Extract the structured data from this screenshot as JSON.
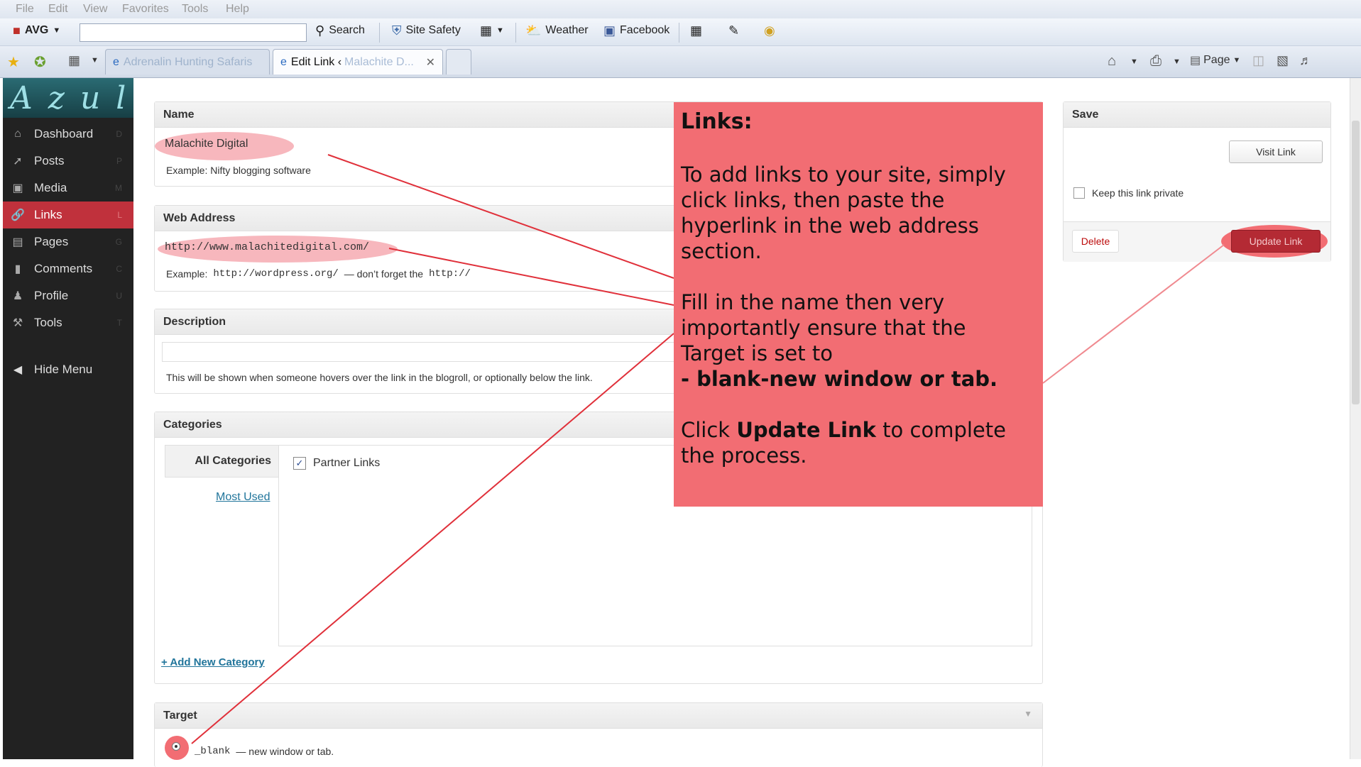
{
  "browser": {
    "menu": [
      "File",
      "Edit",
      "View",
      "Favorites",
      "Tools",
      "Help"
    ],
    "toolbar": {
      "avg": "AVG",
      "search": "Search",
      "site_safety": "Site Safety",
      "weather": "Weather",
      "facebook": "Facebook"
    },
    "tabs": [
      {
        "label": "Adrenalin Hunting Safaris"
      },
      {
        "label": "Edit Link ‹",
        "faded": "Malachite D..."
      }
    ],
    "command_bar": {
      "page": "Page"
    }
  },
  "sidebar": {
    "logo": "Azul",
    "items": [
      {
        "label": "Dashboard",
        "key": "D",
        "icon": "home-icon"
      },
      {
        "label": "Posts",
        "key": "P",
        "icon": "pin-icon"
      },
      {
        "label": "Media",
        "key": "M",
        "icon": "media-icon"
      },
      {
        "label": "Links",
        "key": "L",
        "icon": "link-icon",
        "active": true
      },
      {
        "label": "Pages",
        "key": "G",
        "icon": "page-icon"
      },
      {
        "label": "Comments",
        "key": "C",
        "icon": "comment-icon"
      },
      {
        "label": "Profile",
        "key": "U",
        "icon": "users-icon"
      },
      {
        "label": "Tools",
        "key": "T",
        "icon": "tools-icon"
      }
    ],
    "hide_menu": "Hide Menu"
  },
  "form": {
    "name": {
      "heading": "Name",
      "value": "Malachite Digital",
      "example": "Example: Nifty blogging software"
    },
    "web_address": {
      "heading": "Web Address",
      "value": "http://www.malachitedigital.com/",
      "example_prefix": "Example:",
      "example_url": "http://wordpress.org/",
      "example_mid": "— don’t forget the",
      "example_proto": "http://"
    },
    "description": {
      "heading": "Description",
      "value": "",
      "help": "This will be shown when someone hovers over the link in the blogroll, or optionally below the link."
    },
    "categories": {
      "heading": "Categories",
      "tab_all": "All Categories",
      "tab_most_used": "Most Used",
      "items": [
        {
          "label": "Partner Links",
          "checked": true
        }
      ],
      "add_new": "+ Add New Category"
    },
    "target": {
      "heading": "Target",
      "option": "_blank",
      "option_desc": "— new window or tab."
    }
  },
  "save": {
    "heading": "Save",
    "visit_link": "Visit Link",
    "private_label": "Keep this link private",
    "private_checked": false,
    "delete": "Delete",
    "update": "Update Link"
  },
  "callout": {
    "title": "Links:",
    "p1": "To add links to your site, simply click links, then paste the hyperlink in the web address section.",
    "p2_a": "Fill in the name then very importantly ensure that the Target is set to",
    "p2_b": "- blank-new window or tab.",
    "p3_a": "Click",
    "p3_b": "Update Link",
    "p3_c": "to complete the process."
  },
  "colors": {
    "callout_bg": "#f26d73",
    "highlight": "#f7b7bd",
    "active_menu": "#c0313c",
    "update_button": "#c0313c",
    "annotation_line": "#e0303a"
  }
}
